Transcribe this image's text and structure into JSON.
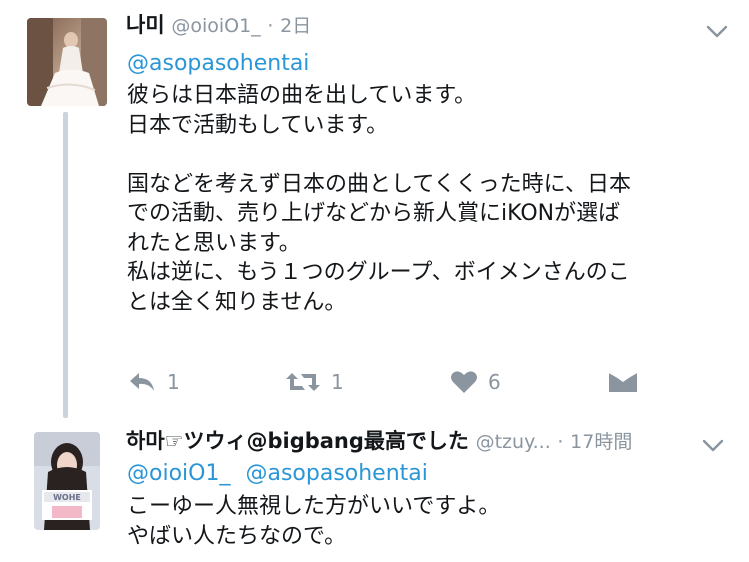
{
  "tweets": [
    {
      "name": "나미",
      "handle": "@oioiO1_",
      "separator": "·",
      "time": "2日",
      "mentions": [
        "@asopasohentai"
      ],
      "lines": [
        "彼らは日本語の曲を出しています。",
        "日本で活動もしています。",
        "",
        "国などを考えず日本の曲としてくくった時に、日本",
        "での活動、売り上げなどから新人賞にiKONが選ば",
        "れたと思います。",
        "私は逆に、もう１つのグループ、ボイメンさんのこ",
        "とは全く知りません。"
      ],
      "actions": {
        "reply_count": "1",
        "retweet_count": "1",
        "like_count": "6"
      },
      "icons": {
        "reply": "reply-icon",
        "retweet": "retweet-icon",
        "like": "heart-icon",
        "dm": "envelope-icon",
        "caret": "chevron-down-icon"
      }
    },
    {
      "name": "하마☞ツウィ@bigbang最高でした",
      "handle": "@tzuy...",
      "separator": "·",
      "time": "17時間",
      "mentions": [
        "@oioiO1_",
        "@asopasohentai"
      ],
      "lines": [
        "こーゆー人無視した方がいいですよ。",
        "やばい人たちなので。"
      ]
    }
  ],
  "colors": {
    "link": "#2b96d6",
    "muted": "#8a95a0",
    "text": "#14171a",
    "thread": "#cbd4da"
  }
}
